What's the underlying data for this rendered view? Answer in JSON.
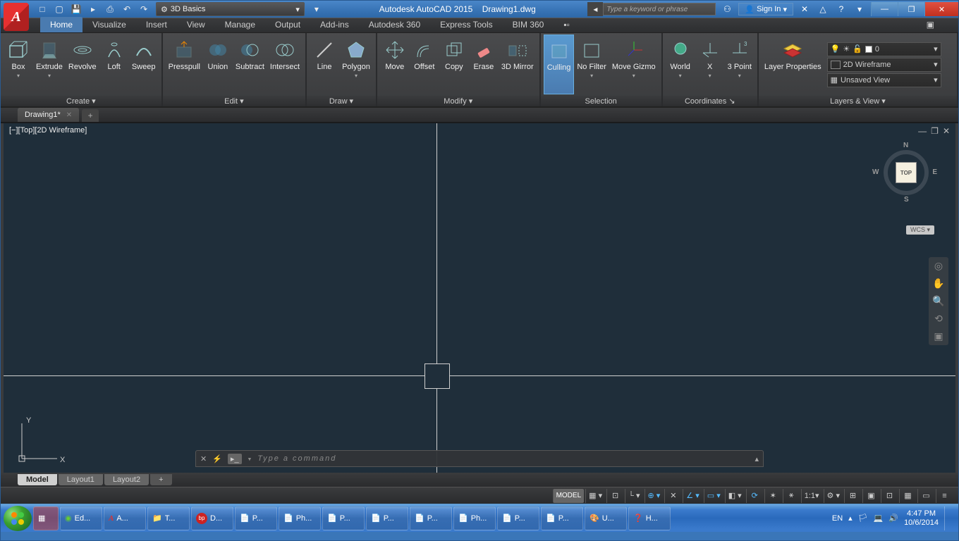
{
  "titlebar": {
    "workspace": "3D Basics",
    "app": "Autodesk AutoCAD 2015",
    "file": "Drawing1.dwg",
    "search_placeholder": "Type a keyword or phrase",
    "signin": "Sign In"
  },
  "tabs": {
    "items": [
      "Home",
      "Visualize",
      "Insert",
      "View",
      "Manage",
      "Output",
      "Add-ins",
      "Autodesk 360",
      "Express Tools",
      "BIM 360"
    ],
    "active": "Home"
  },
  "panels": {
    "create": {
      "title": "Create",
      "tools": [
        "Box",
        "Extrude",
        "Revolve",
        "Loft",
        "Sweep"
      ]
    },
    "edit": {
      "title": "Edit",
      "tools": [
        "Presspull",
        "Union",
        "Subtract",
        "Intersect"
      ]
    },
    "draw": {
      "title": "Draw",
      "tools": [
        "Line",
        "Polygon"
      ]
    },
    "modify": {
      "title": "Modify",
      "tools": [
        "Move",
        "Offset",
        "Copy",
        "Erase",
        "3D Mirror"
      ]
    },
    "selection": {
      "title": "Selection",
      "tools": [
        "Culling",
        "No Filter",
        "Move Gizmo"
      ]
    },
    "coords": {
      "title": "Coordinates",
      "tools": [
        "World",
        "X",
        "3 Point"
      ]
    },
    "layers": {
      "title": "Layers & View",
      "tool": "Layer Properties",
      "layer_value": "0",
      "visual_style": "2D Wireframe",
      "view_name": "Unsaved View"
    }
  },
  "filetabs": {
    "name": "Drawing1*"
  },
  "viewport": {
    "label": "[−][Top][2D Wireframe]",
    "cube_face": "TOP",
    "cube_n": "N",
    "cube_s": "S",
    "cube_e": "E",
    "cube_w": "W",
    "wcs": "WCS",
    "axis_x": "X",
    "axis_y": "Y"
  },
  "cmdline": {
    "placeholder": "Type a command"
  },
  "layouts": {
    "items": [
      "Model",
      "Layout1",
      "Layout2"
    ],
    "active": "Model"
  },
  "statusbar": {
    "model": "MODEL",
    "scale": "1:1"
  },
  "taskbar": {
    "items": [
      "Ed...",
      "A...",
      "T...",
      "D...",
      "P...",
      "Ph...",
      "P...",
      "P...",
      "P...",
      "Ph...",
      "P...",
      "P...",
      "U...",
      "H..."
    ],
    "lang": "EN",
    "time": "4:47 PM",
    "date": "10/6/2014"
  }
}
